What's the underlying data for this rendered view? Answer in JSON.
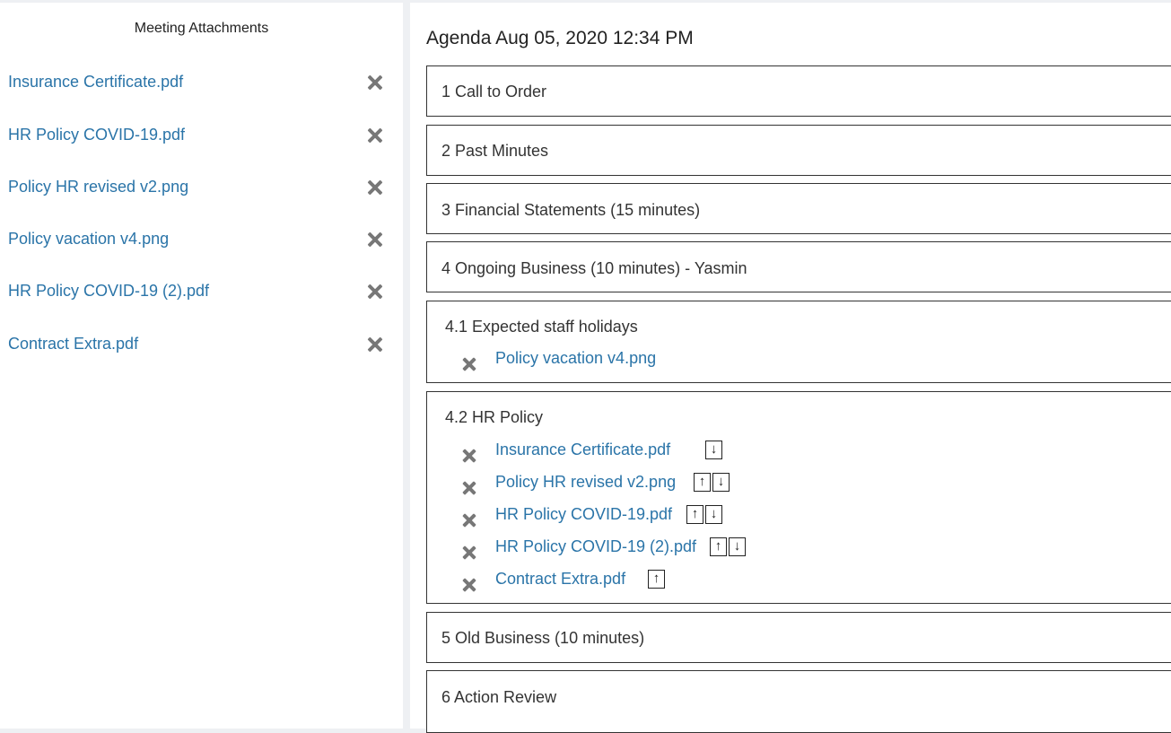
{
  "sidebar": {
    "title": "Meeting Attachments",
    "attachments": [
      {
        "name": "Insurance Certificate.pdf"
      },
      {
        "name": "HR Policy COVID-19.pdf"
      },
      {
        "name": "Policy HR revised v2.png"
      },
      {
        "name": "Policy vacation v4.png"
      },
      {
        "name": "HR Policy COVID-19 (2).pdf"
      },
      {
        "name": "Contract Extra.pdf"
      }
    ]
  },
  "agenda": {
    "title": "Agenda Aug 05, 2020 12:34 PM",
    "items": [
      {
        "label": "1 Call to Order"
      },
      {
        "label": "2 Past Minutes"
      },
      {
        "label": "3 Financial Statements (15 minutes)"
      },
      {
        "label": "4 Ongoing Business (10 minutes) - Yasmin"
      },
      {
        "label": "4.1 Expected staff holidays",
        "attachments": [
          {
            "name": "Policy vacation v4.png"
          }
        ]
      },
      {
        "label": "4.2 HR Policy",
        "attachments": [
          {
            "name": "Insurance Certificate.pdf",
            "arrows": [
              "down"
            ]
          },
          {
            "name": "Policy HR revised v2.png",
            "arrows": [
              "up",
              "down"
            ]
          },
          {
            "name": "HR Policy COVID-19.pdf",
            "arrows": [
              "up",
              "down"
            ]
          },
          {
            "name": "HR Policy COVID-19 (2).pdf",
            "arrows": [
              "up",
              "down"
            ]
          },
          {
            "name": "Contract Extra.pdf",
            "arrows": [
              "up"
            ]
          }
        ]
      },
      {
        "label": "5 Old Business (10 minutes)"
      },
      {
        "label": "6 Action Review"
      }
    ]
  },
  "icons": {
    "remove": "close-x-icon",
    "up": "arrow-up-icon",
    "down": "arrow-down-icon"
  },
  "colors": {
    "link": "#2a74a8",
    "remove_icon": "#777777",
    "border": "#333333"
  }
}
